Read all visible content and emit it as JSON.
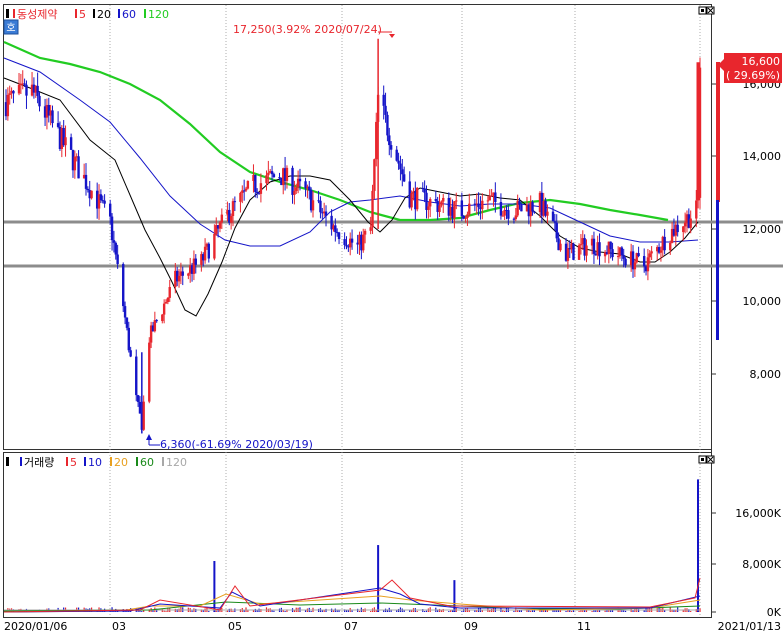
{
  "price_panel": {
    "legend": {
      "stock_name": "동성제약",
      "ma_labels": [
        "5",
        "20",
        "60",
        "120"
      ]
    },
    "mode_button": "호",
    "current_price": "16,600",
    "current_change": "( 29.69%)",
    "high_annotation": "17,250(3.92% 2020/07/24)",
    "low_annotation": "6,360(-61.69% 2020/03/19)",
    "y_ticks": [
      "16,000",
      "14,000",
      "12,000",
      "10,000",
      "8,000"
    ]
  },
  "volume_panel": {
    "legend": {
      "title": "거래량",
      "ma_labels": [
        "5",
        "10",
        "20",
        "60",
        "120"
      ]
    },
    "y_ticks": [
      "16,000K",
      "8,000K",
      "0K"
    ]
  },
  "x_axis": {
    "start_date": "2020/01/06",
    "end_date": "2021/01/13",
    "month_labels": [
      "03",
      "05",
      "07",
      "09",
      "11"
    ]
  },
  "colors": {
    "up": "#e8262d",
    "down": "#1414c8",
    "ma5": "#e8262d",
    "ma20": "#000000",
    "ma60": "#1414c8",
    "ma120": "#22cc22",
    "support": "#8c8c8c",
    "vol_ma10": "#1414c8",
    "vol_ma20": "#e8a020",
    "vol_ma60": "#1a8a1a",
    "vol_ma120": "#a8a8a8"
  },
  "chart_data": [
    {
      "type": "candlestick",
      "stock": "동성제약",
      "x_range": [
        "2020/01/06",
        "2021/01/13"
      ],
      "ylim": [
        6000,
        17400
      ],
      "support_levels": [
        12200,
        11000
      ],
      "highlights": [
        {
          "label": "high",
          "date": "2020/07/24",
          "value": 17250
        },
        {
          "label": "low",
          "date": "2020/03/19",
          "value": 6360
        },
        {
          "label": "last",
          "date": "2021/01/13",
          "value": 16600
        }
      ],
      "close_series": {
        "dates": [
          "2020/01/06",
          "2020/01/20",
          "2020/02/03",
          "2020/02/17",
          "2020/03/02",
          "2020/03/09",
          "2020/03/16",
          "2020/03/19",
          "2020/03/23",
          "2020/04/06",
          "2020/04/20",
          "2020/05/04",
          "2020/05/18",
          "2020/06/01",
          "2020/06/15",
          "2020/06/29",
          "2020/07/13",
          "2020/07/20",
          "2020/07/24",
          "2020/08/10",
          "2020/08/24",
          "2020/09/07",
          "2020/09/21",
          "2020/10/05",
          "2020/10/19",
          "2020/11/02",
          "2020/11/16",
          "2020/11/30",
          "2020/12/14",
          "2020/12/28",
          "2021/01/06",
          "2021/01/11",
          "2021/01/12",
          "2021/01/13"
        ],
        "values": [
          15500,
          15800,
          14600,
          13400,
          12200,
          9900,
          7300,
          6600,
          9000,
          10600,
          11100,
          12400,
          13200,
          13500,
          13000,
          12100,
          11500,
          12000,
          15600,
          12900,
          12700,
          12500,
          12800,
          12500,
          12700,
          11300,
          11600,
          11300,
          11000,
          11900,
          12300,
          12500,
          12800,
          16600
        ]
      },
      "ma": {
        "dates": [
          "2020/01/06",
          "2020/02/03",
          "2020/03/02",
          "2020/03/16",
          "2020/04/01",
          "2020/04/20",
          "2020/05/04",
          "2020/05/18",
          "2020/06/01",
          "2020/06/15",
          "2020/07/01",
          "2020/07/24",
          "2020/08/17",
          "2020/09/07",
          "2020/10/05",
          "2020/11/02",
          "2020/11/30",
          "2020/12/21",
          "2021/01/13"
        ],
        "ma20": [
          15800,
          15200,
          13000,
          11000,
          9600,
          10200,
          11200,
          12400,
          13100,
          13300,
          12800,
          12400,
          12600,
          12600,
          12500,
          11700,
          11500,
          11300,
          12000
        ],
        "ma60": [
          16000,
          15600,
          14400,
          13000,
          12000,
          11700,
          11800,
          11800,
          12000,
          12500,
          12800,
          12700,
          12700,
          12700,
          12600,
          12000,
          11700,
          11600,
          11700
        ],
        "ma120": [
          16400,
          16200,
          15800,
          15400,
          14800,
          14200,
          13700,
          13400,
          13200,
          12900,
          12600,
          12400,
          12500,
          12800,
          12700,
          12700,
          12500,
          12300,
          12300
        ]
      }
    },
    {
      "type": "bar",
      "name": "거래량",
      "ylim": [
        0,
        21000
      ],
      "unit": "K",
      "spikes": [
        {
          "date": "2020/04/27",
          "value": 8000
        },
        {
          "date": "2020/07/24",
          "value": 10500
        },
        {
          "date": "2020/09/03",
          "value": 5000
        },
        {
          "date": "2021/01/13",
          "value": 20800
        }
      ]
    }
  ]
}
